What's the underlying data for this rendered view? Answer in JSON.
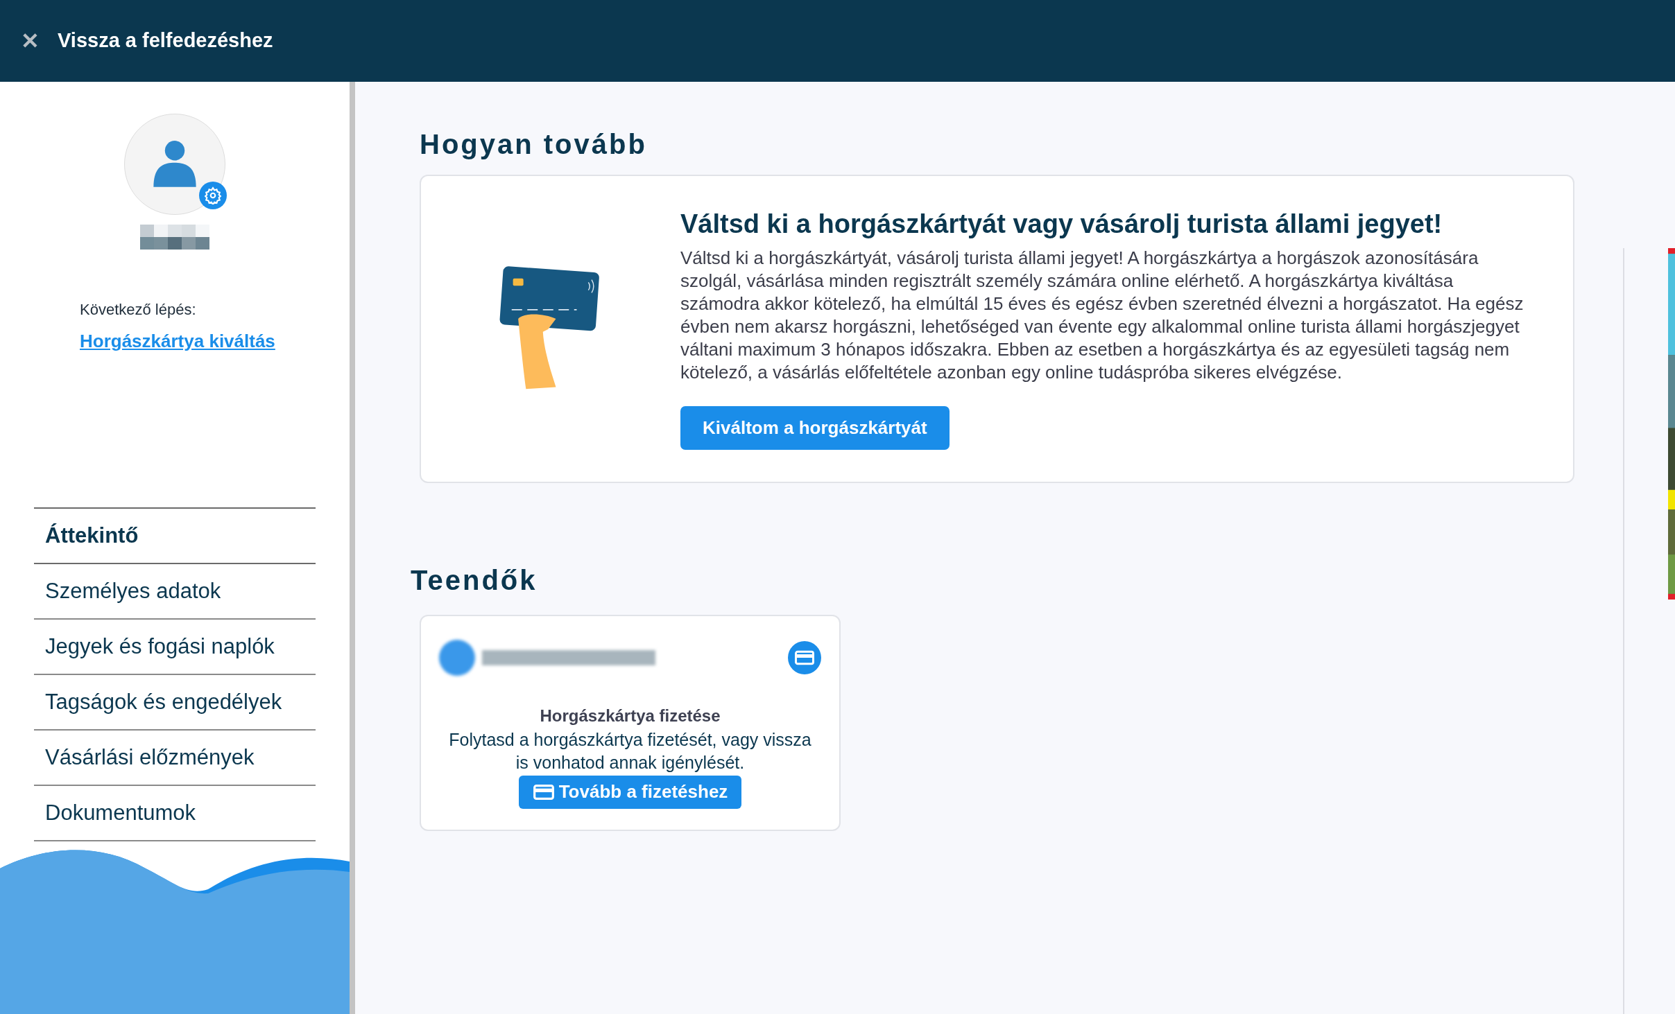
{
  "header": {
    "close_icon": "✕",
    "back_label": "Vissza a felfedezéshez"
  },
  "sidebar": {
    "next_step_label": "Következő lépés:",
    "next_step_link": "Horgászkártya kiváltás",
    "nav": [
      {
        "label": "Áttekintő",
        "selected": true
      },
      {
        "label": "Személyes adatok",
        "selected": false
      },
      {
        "label": "Jegyek és fogási naplók",
        "selected": false
      },
      {
        "label": "Tagságok és engedélyek",
        "selected": false
      },
      {
        "label": "Vásárlási előzmények",
        "selected": false
      },
      {
        "label": "Dokumentumok",
        "selected": false
      }
    ]
  },
  "next_steps": {
    "heading": "Hogyan tovább",
    "card_title": "Váltsd ki a horgászkártyát vagy vásárolj turista állami jegyet!",
    "card_text": "Váltsd ki a horgászkártyát, vásárolj turista állami jegyet! A horgászkártya a horgászok azonosítására szolgál, vásárlása minden regisztrált személy számára online elérhető. A horgászkártya kiváltása számodra akkor kötelező, ha elmúltál 15 éves és egész évben szeretnéd élvezni a horgászatot. Ha egész évben nem akarsz horgászni, lehetőséged van évente egy alkalommal online turista állami horgászjegyet váltani maximum 3 hónapos időszakra. Ebben az esetben a horgászkártya és az egyesületi tagság nem kötelező, a vásárlás előfeltétele azonban egy online tudáspróba sikeres elvégzése.",
    "button": "Kiváltom a horgászkártyát"
  },
  "todos": {
    "heading": "Teendők",
    "items": [
      {
        "title": "Horgászkártya fizetése",
        "text": "Folytasd a horgászkártya fizetését, vagy vissza is vonhatod annak igénylését.",
        "button": "Tovább a fizetéshez"
      }
    ]
  }
}
